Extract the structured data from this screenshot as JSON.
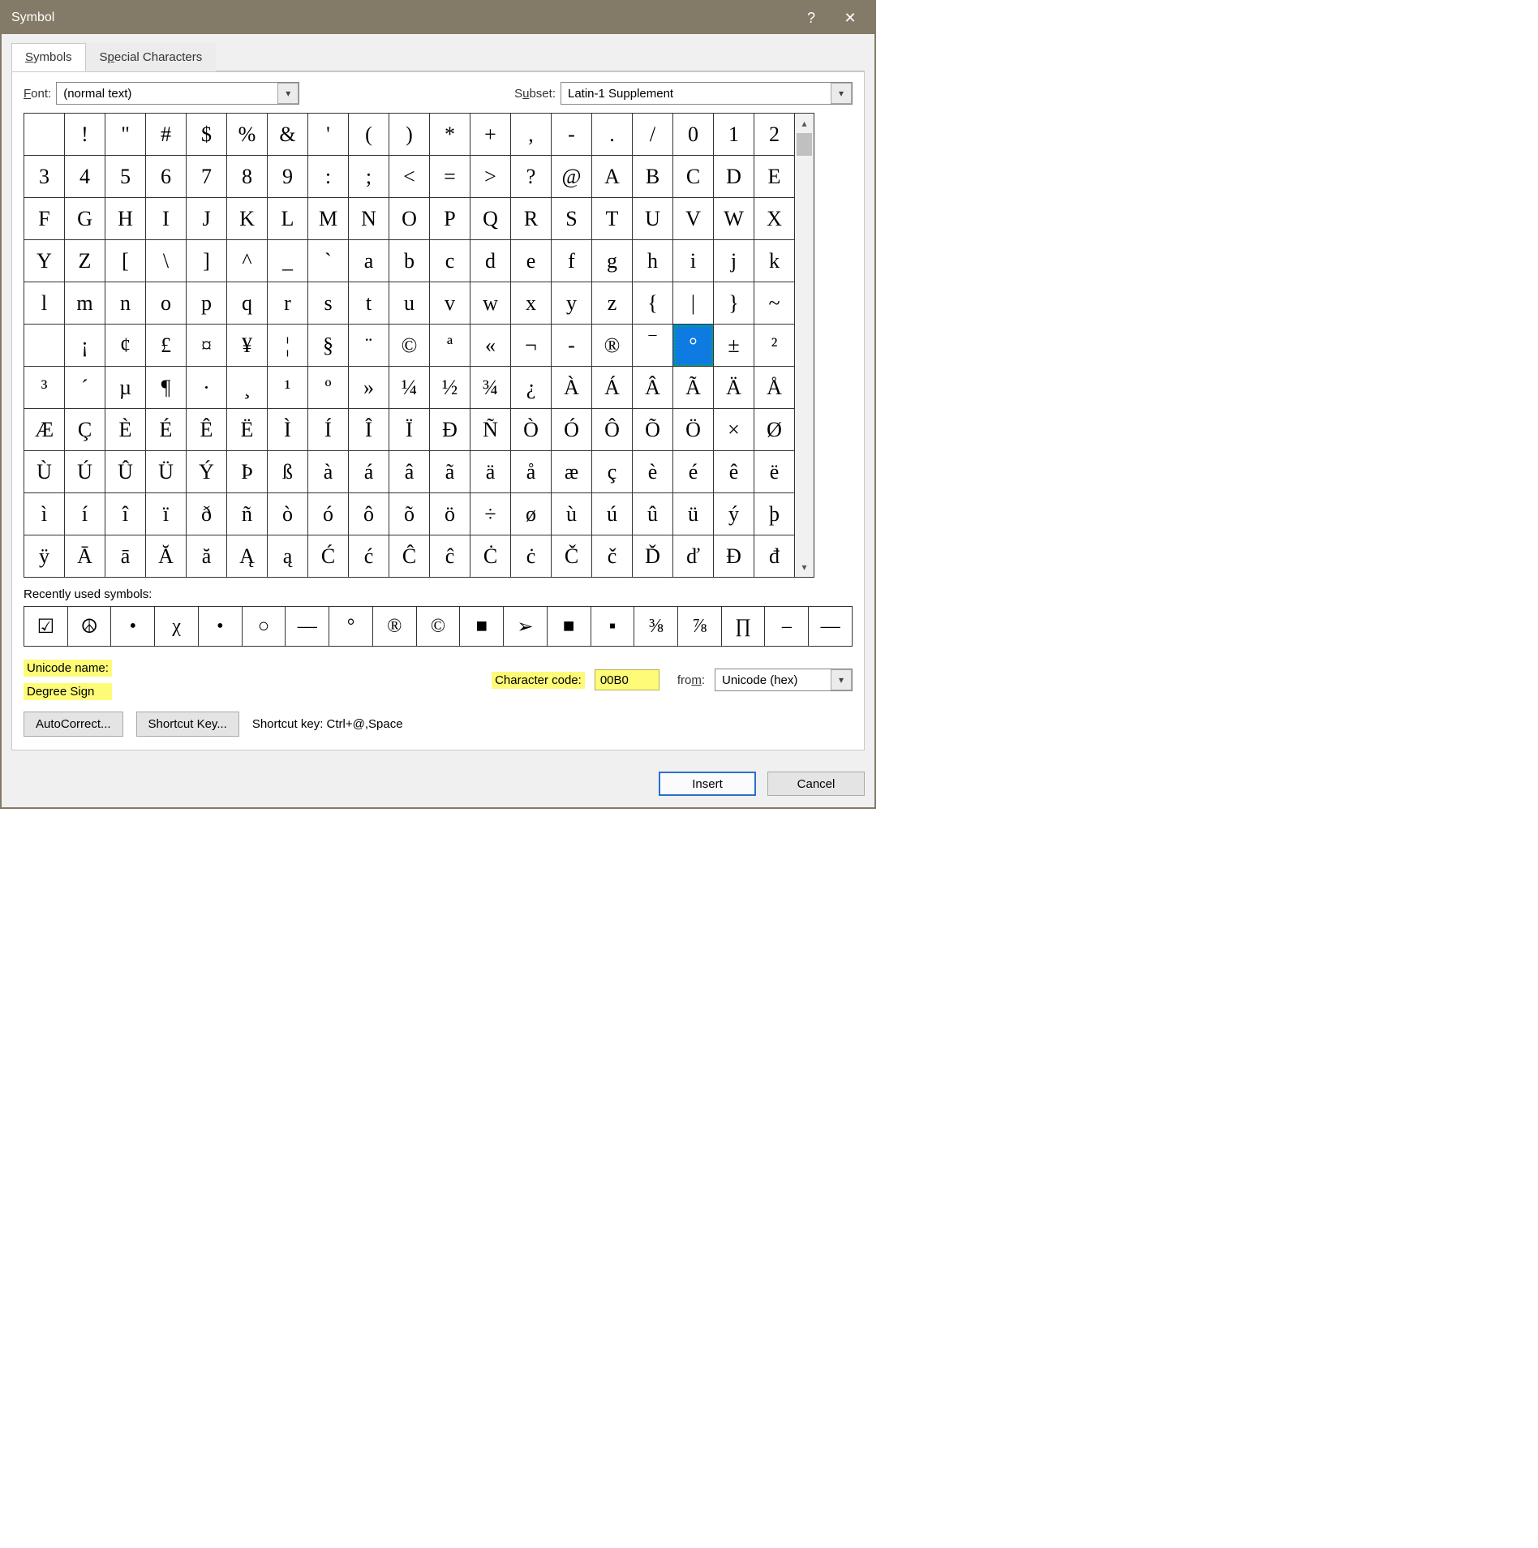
{
  "title": "Symbol",
  "tabs": {
    "symbols": "Symbols",
    "special": "Special Characters"
  },
  "font": {
    "label": "Font:",
    "value": "(normal text)"
  },
  "subset": {
    "label": "Subset:",
    "value": "Latin-1 Supplement"
  },
  "grid": [
    [
      "",
      "!",
      "\"",
      "#",
      "$",
      "%",
      "&",
      "'",
      "(",
      ")",
      "*",
      "+",
      ",",
      "-",
      ".",
      "/",
      "0",
      "1",
      "2"
    ],
    [
      "3",
      "4",
      "5",
      "6",
      "7",
      "8",
      "9",
      ":",
      ";",
      "<",
      "=",
      ">",
      "?",
      "@",
      "A",
      "B",
      "C",
      "D",
      "E"
    ],
    [
      "F",
      "G",
      "H",
      "I",
      "J",
      "K",
      "L",
      "M",
      "N",
      "O",
      "P",
      "Q",
      "R",
      "S",
      "T",
      "U",
      "V",
      "W",
      "X"
    ],
    [
      "Y",
      "Z",
      "[",
      "\\",
      "]",
      "^",
      "_",
      "`",
      "a",
      "b",
      "c",
      "d",
      "e",
      "f",
      "g",
      "h",
      "i",
      "j",
      "k"
    ],
    [
      "l",
      "m",
      "n",
      "o",
      "p",
      "q",
      "r",
      "s",
      "t",
      "u",
      "v",
      "w",
      "x",
      "y",
      "z",
      "{",
      "|",
      "}",
      "~"
    ],
    [
      "",
      "¡",
      "¢",
      "£",
      "¤",
      "¥",
      "¦",
      "§",
      "¨",
      "©",
      "ª",
      "«",
      "¬",
      "-",
      "®",
      "‾",
      "°",
      "±",
      "²"
    ],
    [
      "³",
      "´",
      "µ",
      "¶",
      "·",
      "¸",
      "¹",
      "º",
      "»",
      "¼",
      "½",
      "¾",
      "¿",
      "À",
      "Á",
      "Â",
      "Ã",
      "Ä",
      "Å"
    ],
    [
      "Æ",
      "Ç",
      "È",
      "É",
      "Ê",
      "Ë",
      "Ì",
      "Í",
      "Î",
      "Ï",
      "Ð",
      "Ñ",
      "Ò",
      "Ó",
      "Ô",
      "Õ",
      "Ö",
      "×",
      "Ø"
    ],
    [
      "Ù",
      "Ú",
      "Û",
      "Ü",
      "Ý",
      "Þ",
      "ß",
      "à",
      "á",
      "â",
      "ã",
      "ä",
      "å",
      "æ",
      "ç",
      "è",
      "é",
      "ê",
      "ë"
    ],
    [
      "ì",
      "í",
      "î",
      "ï",
      "ð",
      "ñ",
      "ò",
      "ó",
      "ô",
      "õ",
      "ö",
      "÷",
      "ø",
      "ù",
      "ú",
      "û",
      "ü",
      "ý",
      "þ"
    ],
    [
      "ÿ",
      "Ā",
      "ā",
      "Ă",
      "ă",
      "Ą",
      "ą",
      "Ć",
      "ć",
      "Ĉ",
      "ĉ",
      "Ċ",
      "ċ",
      "Č",
      "č",
      "Ď",
      "ď",
      "Đ",
      "đ"
    ]
  ],
  "selected": {
    "row": 5,
    "col": 16
  },
  "recent_label": "Recently used symbols:",
  "recent": [
    "☑",
    "☮",
    "•",
    "χ",
    "•",
    "○",
    "—",
    "°",
    "®",
    "©",
    "■",
    "➢",
    "■",
    "▪",
    "⅜",
    "⅞",
    "∏",
    "–",
    "—"
  ],
  "unicode_name_label": "Unicode name:",
  "unicode_name": "Degree Sign",
  "charcode_label": "Character code:",
  "charcode_value": "00B0",
  "from_label": "from:",
  "from_value": "Unicode (hex)",
  "buttons": {
    "autocorrect": "AutoCorrect...",
    "shortcutkey": "Shortcut Key...",
    "shortcut_lbl": "Shortcut key: ",
    "shortcut_val": "Ctrl+@,Space",
    "insert": "Insert",
    "cancel": "Cancel"
  }
}
